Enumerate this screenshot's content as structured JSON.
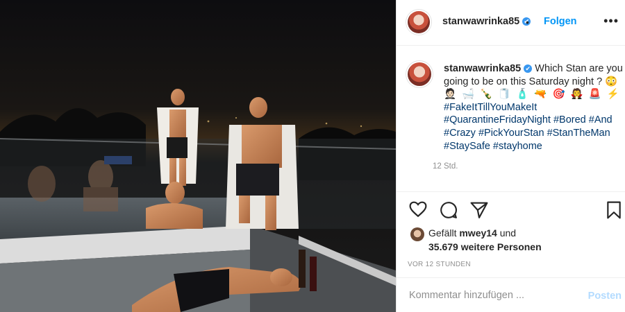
{
  "post": {
    "username": "stanwawrinka85",
    "verified_badge": "✔",
    "separator": "•",
    "follow_label": "Folgen",
    "more_label": "•••"
  },
  "caption": {
    "username": "stanwawrinka85",
    "text_lead": "Which Stan are you going to be on this Saturday night ?",
    "emoji_line_1": "😳",
    "emoji_line_2": "🤵🏻 🛁 🍾 🧻 🧴 🔫 🎯 🧛 🚨 ⚡",
    "hashtags": "#FakeItTillYouMakeIt #QuarantineFridayNight #Bored #And #Crazy #PickYourStan #StanTheMan #StaySafe #stayhome",
    "time_ago": "12 Std."
  },
  "actions": {
    "like_icon": "heart-icon",
    "comment_icon": "comment-icon",
    "share_icon": "send-icon",
    "save_icon": "bookmark-icon"
  },
  "likes": {
    "prefix": "Gefällt",
    "user": "mwey14",
    "conj": "und",
    "rest": "35.679 weitere Personen"
  },
  "timestamp": "VOR 12 STUNDEN",
  "comment_box": {
    "placeholder": "Kommentar hinzufügen ...",
    "post_label": "Posten"
  }
}
